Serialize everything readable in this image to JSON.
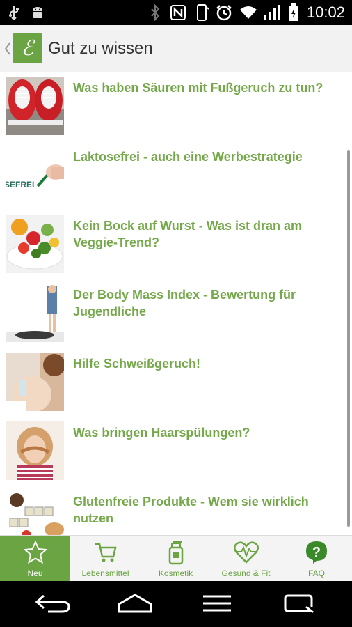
{
  "status_bar": {
    "time": "10:02"
  },
  "header": {
    "title": "Gut zu wissen",
    "logo_letter": "ℰ"
  },
  "articles": [
    {
      "title": "Was haben Säuren mit Fußgeruch zu tun?",
      "thumb": "red-sneakers"
    },
    {
      "title": "Laktosefrei - auch eine Werbestrategie",
      "thumb": "laktosefrei-writing",
      "thumb_text": "SEFREI"
    },
    {
      "title": "Kein Bock auf Wurst - Was ist dran am Veggie-Trend?",
      "thumb": "veggie-plate"
    },
    {
      "title": "Der Body Mass Index - Bewertung für Jugendliche",
      "thumb": "scale"
    },
    {
      "title": "Hilfe Schweißgeruch!",
      "thumb": "armpit"
    },
    {
      "title": "Was bringen Haarspülungen?",
      "thumb": "hair-woman"
    },
    {
      "title": "Glutenfreie Produkte - Wem sie wirklich nutzen",
      "thumb": "gluten-letters"
    }
  ],
  "tabs": [
    {
      "label": "Neu",
      "icon": "star-icon",
      "active": true
    },
    {
      "label": "Lebensmittel",
      "icon": "cart-icon",
      "active": false
    },
    {
      "label": "Kosmetik",
      "icon": "bottle-icon",
      "active": false
    },
    {
      "label": "Gesund & Fit",
      "icon": "heart-pulse-icon",
      "active": false
    },
    {
      "label": "FAQ",
      "icon": "question-icon",
      "active": false
    }
  ],
  "colors": {
    "brand_green": "#6aa443",
    "title_green": "#74a84a"
  }
}
